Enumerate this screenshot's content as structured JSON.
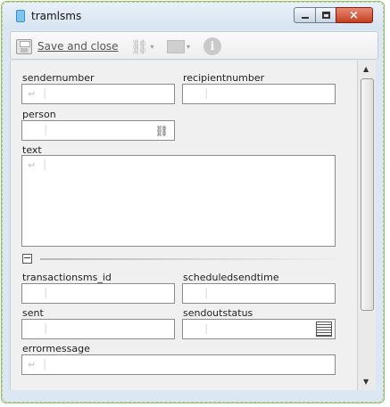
{
  "window": {
    "title": "tramlsms"
  },
  "toolbar": {
    "save_label": "Save and close",
    "link_icon": "link-icon",
    "outlook_icon": "outlook-icon",
    "info_icon": "info-icon",
    "info_glyph": "i"
  },
  "glyphs": {
    "enter": "↵",
    "cursor": "⏐",
    "caret": "▾",
    "collapse": "−",
    "link": "⛓"
  },
  "fields": {
    "sendernumber": {
      "label": "sendernumber",
      "value": ""
    },
    "recipientnumber": {
      "label": "recipientnumber",
      "value": ""
    },
    "person": {
      "label": "person",
      "value": ""
    },
    "text": {
      "label": "text",
      "value": ""
    },
    "transactionsms_id": {
      "label": "transactionsms_id",
      "value": ""
    },
    "scheduledsendtime": {
      "label": "scheduledsendtime",
      "value": ""
    },
    "sent": {
      "label": "sent",
      "value": ""
    },
    "sendoutstatus": {
      "label": "sendoutstatus",
      "value": ""
    },
    "errormessage": {
      "label": "errormessage",
      "value": ""
    }
  }
}
